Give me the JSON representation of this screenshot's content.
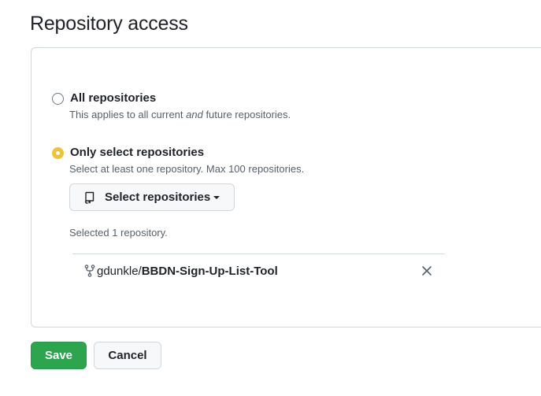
{
  "header": {
    "title": "Repository access"
  },
  "options": [
    {
      "label": "All repositories",
      "desc_pre": "This applies to all current ",
      "desc_em": "and",
      "desc_post": " future repositories.",
      "checked": false
    },
    {
      "label": "Only select repositories",
      "desc": "Select at least one repository. Max 100 repositories.",
      "checked": true
    }
  ],
  "select_button": {
    "label": "Select repositories",
    "icon": "repo-icon"
  },
  "selected_count": "Selected 1 repository.",
  "repositories": [
    {
      "owner": "gdunkle/",
      "name": "BBDN-Sign-Up-List-Tool",
      "icon": "fork-icon"
    }
  ],
  "actions": {
    "save": "Save",
    "cancel": "Cancel"
  },
  "colors": {
    "accent_radio": "#f1c232",
    "save_bg": "#2da44e",
    "border": "#d0d7de"
  }
}
